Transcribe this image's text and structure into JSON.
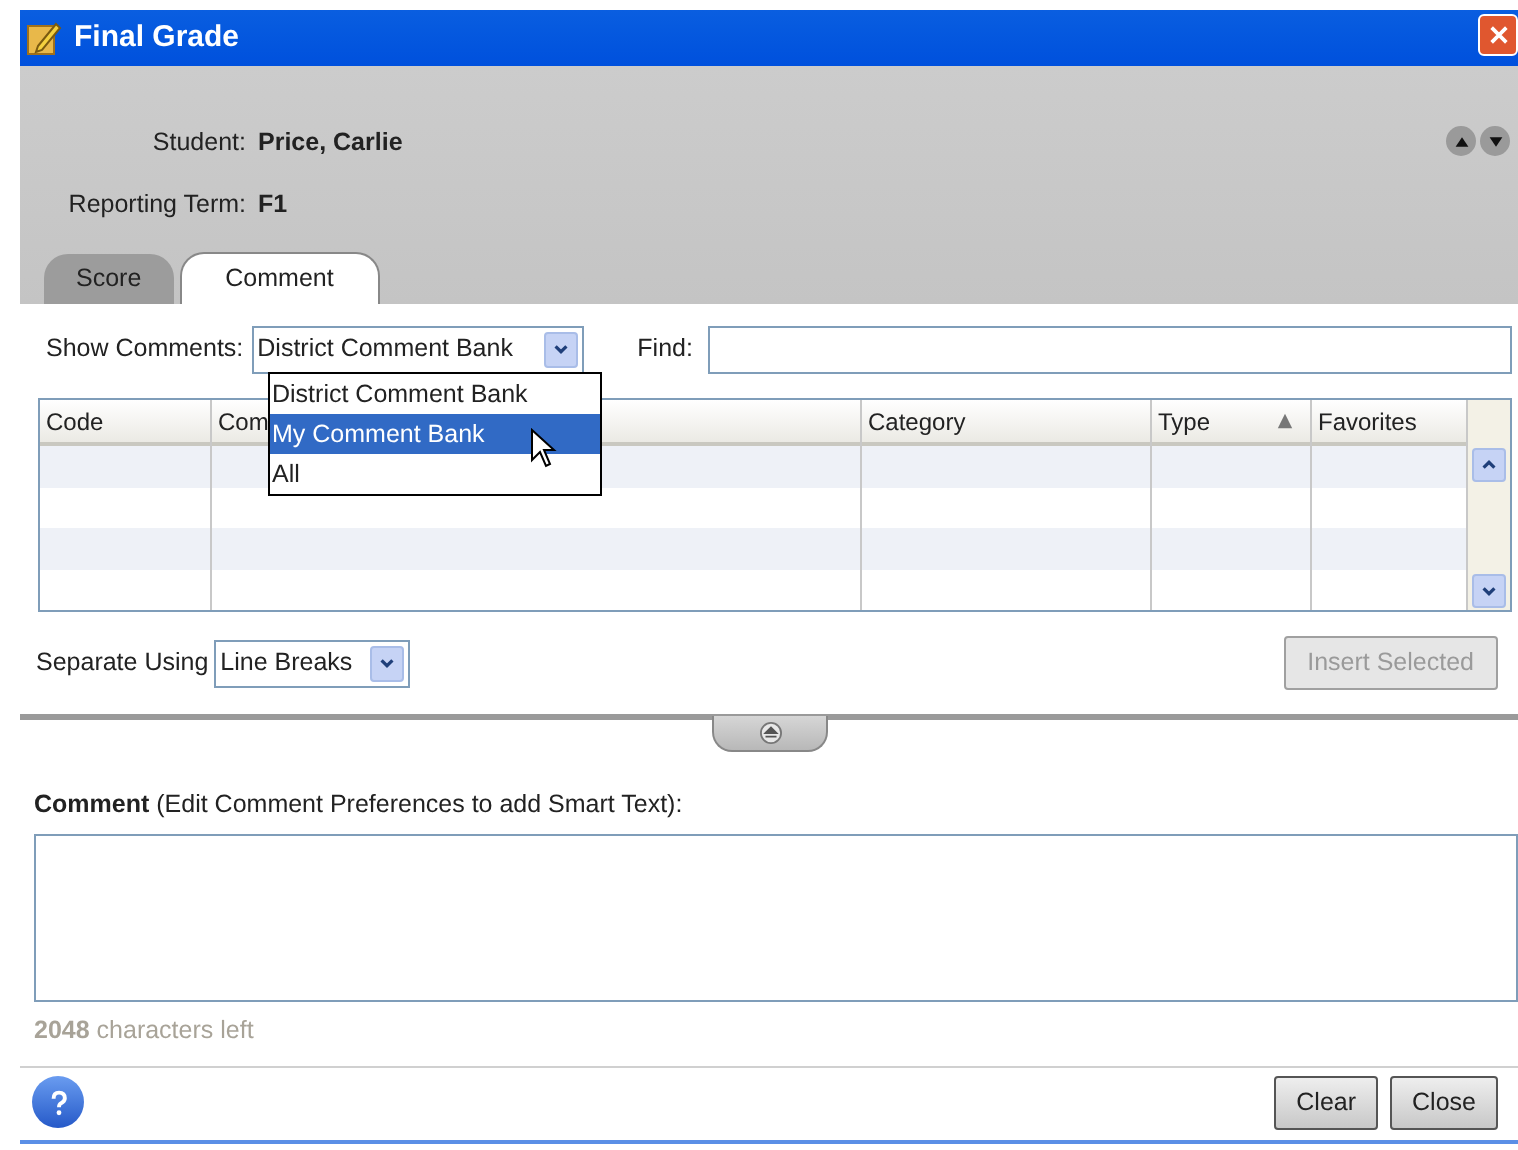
{
  "window": {
    "title": "Final Grade"
  },
  "header": {
    "fields": [
      {
        "label": "Student:",
        "value": "Price, Carlie"
      },
      {
        "label": "Reporting Term:",
        "value": "F1"
      }
    ]
  },
  "tabs": [
    {
      "label": "Score",
      "selected": false
    },
    {
      "label": "Comment",
      "selected": true
    }
  ],
  "show_comments": {
    "label": "Show Comments:",
    "value": "District Comment Bank",
    "expanded": true,
    "options": [
      {
        "label": "District Comment Bank",
        "highlighted": false
      },
      {
        "label": "My Comment Bank",
        "highlighted": true
      },
      {
        "label": "All",
        "highlighted": false
      }
    ]
  },
  "find": {
    "label": "Find:"
  },
  "table": {
    "columns": [
      {
        "label": "Code",
        "sorted": false
      },
      {
        "label": "Com",
        "sorted": false
      },
      {
        "label": "Category",
        "sorted": false
      },
      {
        "label": "Type",
        "sorted": true
      },
      {
        "label": "Favorites",
        "sorted": false
      }
    ]
  },
  "separate_using": {
    "label": "Separate Using",
    "value": "Line Breaks"
  },
  "insert_button": {
    "label": "Insert Selected",
    "disabled": true
  },
  "comment": {
    "label": "**Comment** (Edit Comment Preferences to add Smart Text):"
  },
  "counter": "**2048** characters left",
  "buttons": [
    {
      "label": "Clear"
    },
    {
      "label": "Close"
    }
  ]
}
